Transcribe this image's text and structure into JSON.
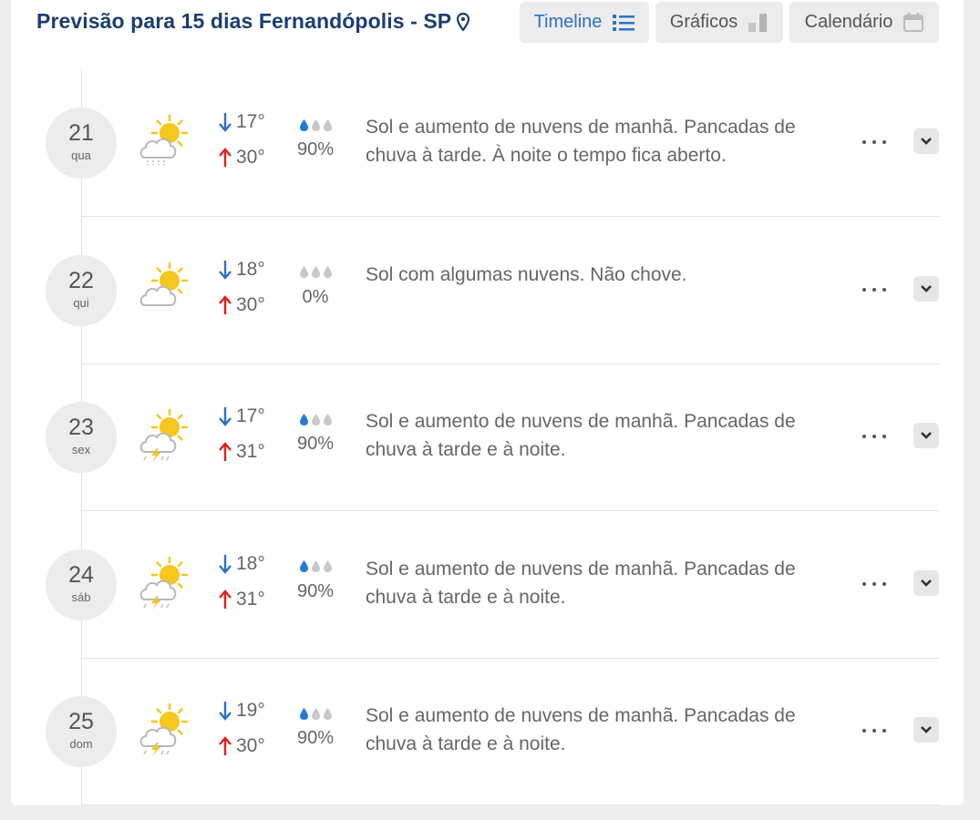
{
  "header": {
    "title": "Previsão para 15 dias Fernandópolis - SP",
    "buttons": [
      {
        "label": "Timeline",
        "active": true
      },
      {
        "label": "Gráficos",
        "active": false
      },
      {
        "label": "Calendário",
        "active": false
      }
    ]
  },
  "colors": {
    "title": "#1b3d72",
    "accent": "#2a72c9",
    "min_arrow": "#2a72c9",
    "max_arrow": "#e0201b",
    "sun": "#f6c71c",
    "drop_active": "#1f7dd6",
    "drop_inactive": "#c8c8c8"
  },
  "days": [
    {
      "day": "21",
      "weekday": "qua",
      "icon": "sun-cloud-drizzle-icon",
      "min": "17°",
      "max": "30°",
      "rain": "90%",
      "rain_level": 1,
      "description": "Sol e aumento de nuvens de manhã. Pancadas de chuva à tarde. À noite o tempo fica aberto."
    },
    {
      "day": "22",
      "weekday": "qui",
      "icon": "sun-cloud-icon",
      "min": "18°",
      "max": "30°",
      "rain": "0%",
      "rain_level": 0,
      "description": "Sol com algumas nuvens. Não chove."
    },
    {
      "day": "23",
      "weekday": "sex",
      "icon": "sun-cloud-storm-icon",
      "min": "17°",
      "max": "31°",
      "rain": "90%",
      "rain_level": 1,
      "description": "Sol e aumento de nuvens de manhã. Pancadas de chuva à tarde e à noite."
    },
    {
      "day": "24",
      "weekday": "sáb",
      "icon": "sun-cloud-storm-icon",
      "min": "18°",
      "max": "31°",
      "rain": "90%",
      "rain_level": 1,
      "description": "Sol e aumento de nuvens de manhã. Pancadas de chuva à tarde e à noite."
    },
    {
      "day": "25",
      "weekday": "dom",
      "icon": "sun-cloud-storm-icon",
      "min": "19°",
      "max": "30°",
      "rain": "90%",
      "rain_level": 1,
      "description": "Sol e aumento de nuvens de manhã. Pancadas de chuva à tarde e à noite."
    }
  ]
}
